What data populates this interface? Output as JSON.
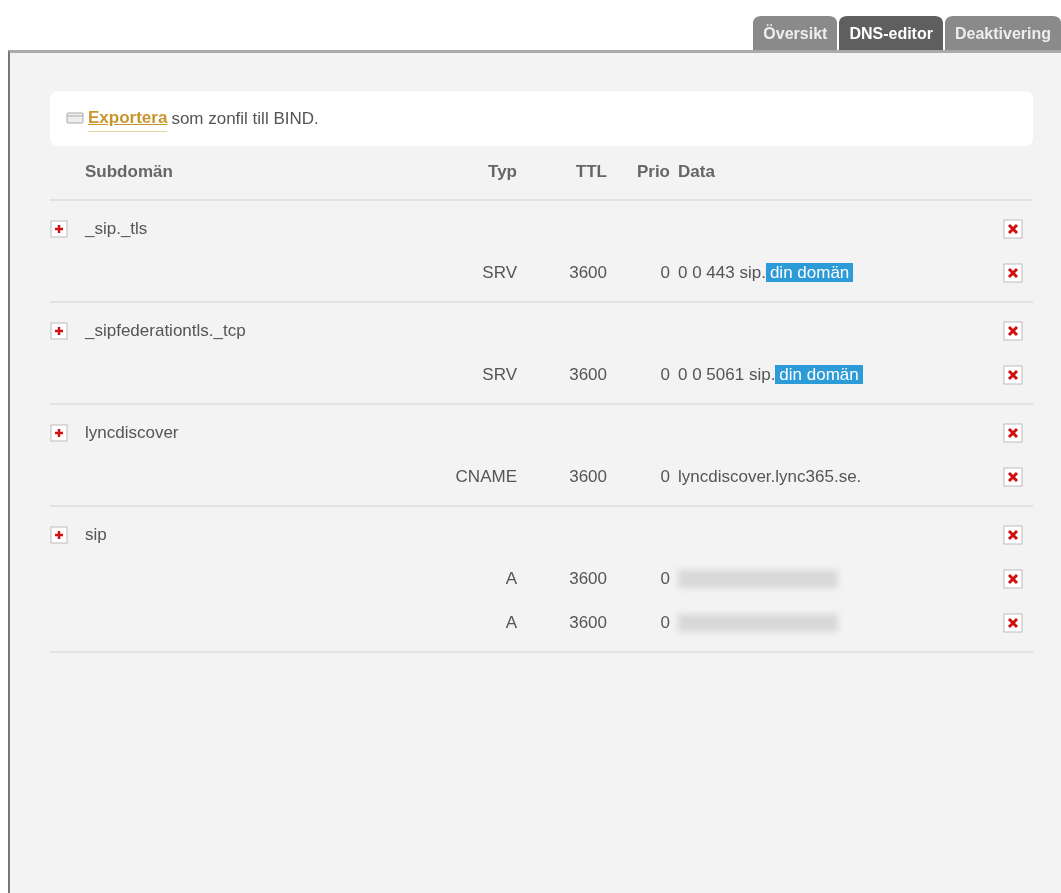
{
  "tabs": [
    {
      "label": "Översikt",
      "selected": false
    },
    {
      "label": "DNS-editor",
      "selected": true
    },
    {
      "label": "Deaktivering",
      "selected": false
    }
  ],
  "export": {
    "link": "Exportera",
    "text": "som zonfil till BIND."
  },
  "columns": [
    "Subdomän",
    "Typ",
    "TTL",
    "Prio",
    "Data"
  ],
  "groups": [
    {
      "name": "_sip._tls",
      "records": [
        {
          "type": "SRV",
          "ttl": "3600",
          "prio": "0",
          "data": "0 0 443 sip.",
          "selection": "din domän",
          "redacted": false
        }
      ]
    },
    {
      "name": "_sipfederationtls._tcp",
      "records": [
        {
          "type": "SRV",
          "ttl": "3600",
          "prio": "0",
          "data": "0 0 5061 sip.",
          "selection": "din domän",
          "redacted": false
        }
      ]
    },
    {
      "name": "lyncdiscover",
      "records": [
        {
          "type": "CNAME",
          "ttl": "3600",
          "prio": "0",
          "data": "lyncdiscover.lync365.se.",
          "redacted": false
        }
      ]
    },
    {
      "name": "sip",
      "records": [
        {
          "type": "A",
          "ttl": "3600",
          "prio": "0",
          "redacted": true
        },
        {
          "type": "A",
          "ttl": "3600",
          "prio": "0",
          "redacted": true
        }
      ]
    }
  ]
}
